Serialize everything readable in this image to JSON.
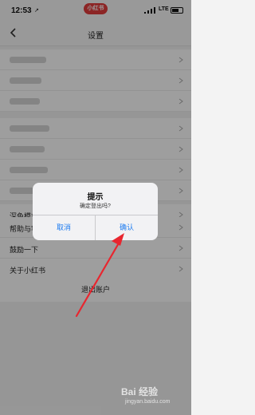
{
  "status_bar": {
    "time": "12:53",
    "location_glyph": "↗",
    "app_pill": "小红书",
    "network": "LTE"
  },
  "nav": {
    "title": "设置",
    "back_icon": "chevron-left-icon"
  },
  "settings": {
    "blurred_group_1_rows": 3,
    "blurred_group_2_rows": 4,
    "rows": [
      {
        "label": "深色模式"
      },
      {
        "label": "帮助与客服"
      },
      {
        "label": "鼓励一下"
      },
      {
        "label": "关于小红书"
      }
    ],
    "logout": "退出账户"
  },
  "dialog": {
    "title": "提示",
    "message": "确定登出吗?",
    "cancel": "取消",
    "confirm": "确认"
  },
  "annotation": {
    "arrow_color": "#e8262f"
  },
  "watermark": {
    "logo": "Bai 经验",
    "url": "jingyan.baidu.com"
  },
  "colors": {
    "accent": "#1e7cf0",
    "brand": "#e23c3c"
  }
}
